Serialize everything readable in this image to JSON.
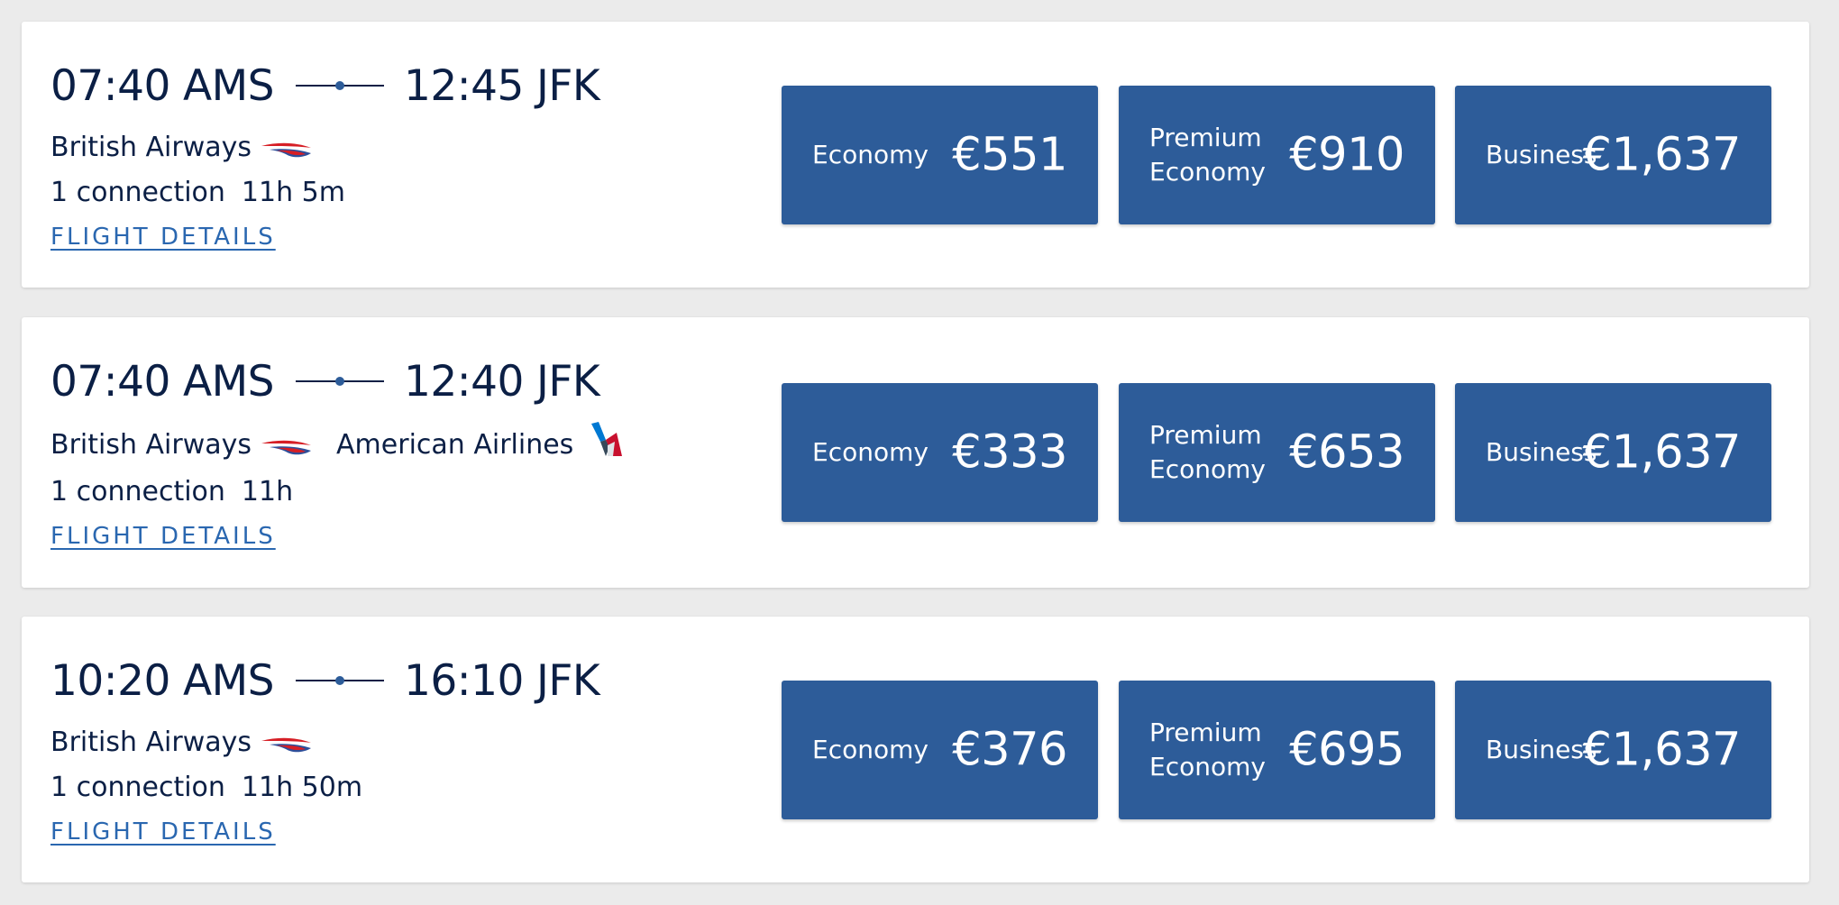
{
  "flights": [
    {
      "depart_time": "07:40",
      "depart_airport": "AMS",
      "arrive_time": "12:45",
      "arrive_airport": "JFK",
      "airlines": [
        "British Airways"
      ],
      "connections": "1 connection",
      "duration": "11h 5m",
      "details_label": "FLIGHT DETAILS",
      "fares": {
        "economy": {
          "cabin": "Economy",
          "price": "€551"
        },
        "premium": {
          "cabin_line1": "Premium",
          "cabin_line2": "Economy",
          "price": "€910"
        },
        "business": {
          "cabin": "Business",
          "price": "€1,637"
        }
      }
    },
    {
      "depart_time": "07:40",
      "depart_airport": "AMS",
      "arrive_time": "12:40",
      "arrive_airport": "JFK",
      "airlines": [
        "British Airways",
        "American Airlines"
      ],
      "connections": "1 connection",
      "duration": "11h",
      "details_label": "FLIGHT DETAILS",
      "fares": {
        "economy": {
          "cabin": "Economy",
          "price": "€333"
        },
        "premium": {
          "cabin_line1": "Premium",
          "cabin_line2": "Economy",
          "price": "€653"
        },
        "business": {
          "cabin": "Business",
          "price": "€1,637"
        }
      }
    },
    {
      "depart_time": "10:20",
      "depart_airport": "AMS",
      "arrive_time": "16:10",
      "arrive_airport": "JFK",
      "airlines": [
        "British Airways"
      ],
      "connections": "1 connection",
      "duration": "11h 50m",
      "details_label": "FLIGHT DETAILS",
      "fares": {
        "economy": {
          "cabin": "Economy",
          "price": "€376"
        },
        "premium": {
          "cabin_line1": "Premium",
          "cabin_line2": "Economy",
          "price": "€695"
        },
        "business": {
          "cabin": "Business",
          "price": "€1,637"
        }
      }
    }
  ],
  "icons": {
    "route": "route-line-icon",
    "ba": "british-airways-logo-icon",
    "aa": "american-airlines-logo-icon"
  },
  "colors": {
    "background": "#ebebeb",
    "card": "#ffffff",
    "text": "#0b1f45",
    "fare_button": "#2d5c99",
    "link": "#2a67b0",
    "ba_red": "#d61f26",
    "ba_blue": "#2e4f9a",
    "aa_red": "#c8102e",
    "aa_blue": "#0078d2"
  }
}
